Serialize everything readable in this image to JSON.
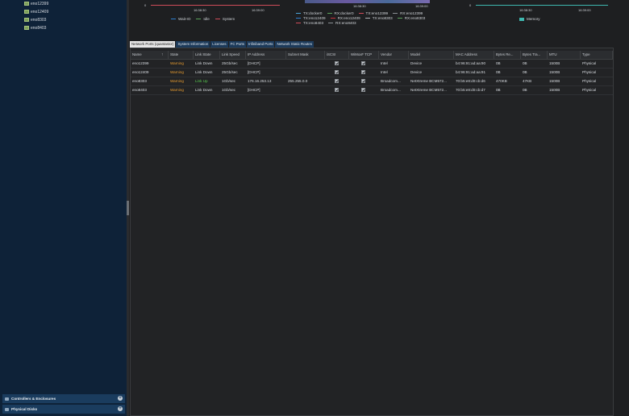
{
  "sidebar": {
    "nics": [
      "eno12399",
      "eno12409",
      "eno8303",
      "eno8403"
    ],
    "sections": [
      {
        "label": "Controllers & Enclosures",
        "icon": "controller-icon"
      },
      {
        "label": "Physical Disks",
        "icon": "disk-icon"
      }
    ]
  },
  "charts": {
    "cpu": {
      "y_zero": "0",
      "x_ticks": [
        "16:38:30",
        "16:39:00"
      ],
      "legend": [
        {
          "label": "Wait-IO",
          "color": "#2e7fd0"
        },
        {
          "label": "Idle",
          "color": "#5aa25a"
        },
        {
          "label": "System",
          "color": "#d04c5a"
        }
      ]
    },
    "network": {
      "x_ticks": [
        "16:38:30",
        "16:39:00"
      ],
      "legend_rows": [
        [
          {
            "label": "TX:docker0",
            "color": "#4aa3d8"
          },
          {
            "label": "RX:docker0",
            "color": "#5aa25a"
          },
          {
            "label": "TX:eno12399",
            "color": "#d04c5a"
          },
          {
            "label": "RX:eno12399",
            "color": "#8a8f94"
          }
        ],
        [
          {
            "label": "TX:eno12409",
            "color": "#2e7fd0"
          },
          {
            "label": "RX:eno12409",
            "color": "#c8323c"
          },
          {
            "label": "TX:eno8303",
            "color": "#b0b4b9"
          },
          {
            "label": "RX:eno8303",
            "color": "#5aa25a"
          }
        ],
        [
          {
            "label": "TX:eno8403",
            "color": "#d04c5a"
          },
          {
            "label": "RX:eno8403",
            "color": "#8a8f94"
          }
        ]
      ]
    },
    "memory": {
      "y_zero": "0",
      "x_ticks": [
        "16:38:30",
        "16:39:00"
      ],
      "legend": [
        {
          "label": "Memory",
          "color": "#3fb8b0"
        }
      ]
    }
  },
  "tabs": [
    {
      "label": "Network Ports (quantastor)",
      "active": true
    },
    {
      "label": "System Information",
      "active": false
    },
    {
      "label": "Licenses",
      "active": false
    },
    {
      "label": "FC Ports",
      "active": false
    },
    {
      "label": "Infiniband Ports",
      "active": false
    },
    {
      "label": "Network Static Routes",
      "active": false
    }
  ],
  "table": {
    "columns": [
      "Name",
      "State",
      "Link State",
      "Link Speed",
      "IP Address",
      "Subnet Mask",
      "iSCSI",
      "WiMoxF TCP",
      "Vendor",
      "Model",
      "MAC Address",
      "Bytes Re...",
      "Bytes Tra...",
      "MTU",
      "Type"
    ],
    "rows": [
      {
        "name": "eno12399",
        "state": "Warning",
        "link_state": "Link Down",
        "link_speed": "25Gb/sec",
        "ip": "[DHCP]",
        "subnet": "",
        "iscsi": true,
        "tcp": true,
        "vendor": "Intel",
        "model": "Device",
        "mac": "b4:96:91:ad:aa:90",
        "rx": "0B",
        "tx": "0B",
        "mtu": "1500B",
        "type": "Physical"
      },
      {
        "name": "eno12409",
        "state": "Warning",
        "link_state": "Link Down",
        "link_speed": "25Gb/sec",
        "ip": "[DHCP]",
        "subnet": "",
        "iscsi": true,
        "tcp": true,
        "vendor": "Intel",
        "model": "Device",
        "mac": "b4:96:91:ad:aa:91",
        "rx": "0B",
        "tx": "0B",
        "mtu": "1500B",
        "type": "Physical"
      },
      {
        "name": "eno8303",
        "state": "Warning",
        "link_state": "Link Up",
        "link_speed": "1Gb/sec",
        "ip": "176.16.253.13",
        "subnet": "255.255.0.0",
        "iscsi": true,
        "tcp": true,
        "vendor": "Broadcom...",
        "model": "NetXtreme BCM572...",
        "mac": "70:b5:e8:d0:cb:d6",
        "rx": "470KB",
        "tx": "47KB",
        "mtu": "1500B",
        "type": "Physical"
      },
      {
        "name": "eno8403",
        "state": "Warning",
        "link_state": "Link Down",
        "link_speed": "1Gb/sec",
        "ip": "[DHCP]",
        "subnet": "",
        "iscsi": true,
        "tcp": true,
        "vendor": "Broadcom...",
        "model": "NetXtreme BCM572...",
        "mac": "70:b5:e8:d0:cb:d7",
        "rx": "0B",
        "tx": "0B",
        "mtu": "1500B",
        "type": "Physical"
      }
    ]
  }
}
